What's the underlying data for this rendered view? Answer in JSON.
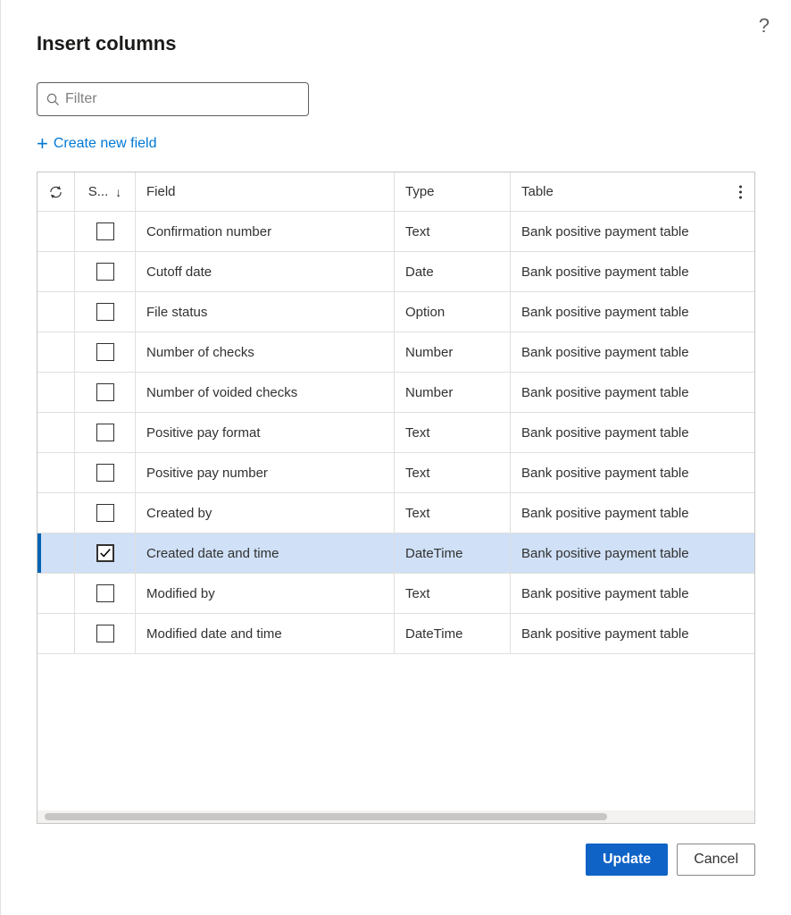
{
  "title": "Insert columns",
  "filter": {
    "placeholder": "Filter"
  },
  "create_link": "Create new field",
  "columns": {
    "select_abbrev": "S...",
    "field": "Field",
    "type": "Type",
    "table": "Table"
  },
  "rows": [
    {
      "field": "Confirmation number",
      "type": "Text",
      "table": "Bank positive payment table",
      "selected": false
    },
    {
      "field": "Cutoff date",
      "type": "Date",
      "table": "Bank positive payment table",
      "selected": false
    },
    {
      "field": "File status",
      "type": "Option",
      "table": "Bank positive payment table",
      "selected": false
    },
    {
      "field": "Number of checks",
      "type": "Number",
      "table": "Bank positive payment table",
      "selected": false
    },
    {
      "field": "Number of voided checks",
      "type": "Number",
      "table": "Bank positive payment table",
      "selected": false
    },
    {
      "field": "Positive pay format",
      "type": "Text",
      "table": "Bank positive payment table",
      "selected": false
    },
    {
      "field": "Positive pay number",
      "type": "Text",
      "table": "Bank positive payment table",
      "selected": false
    },
    {
      "field": "Created by",
      "type": "Text",
      "table": "Bank positive payment table",
      "selected": false
    },
    {
      "field": "Created date and time",
      "type": "DateTime",
      "table": "Bank positive payment table",
      "selected": true
    },
    {
      "field": "Modified by",
      "type": "Text",
      "table": "Bank positive payment table",
      "selected": false
    },
    {
      "field": "Modified date and time",
      "type": "DateTime",
      "table": "Bank positive payment table",
      "selected": false
    }
  ],
  "buttons": {
    "update": "Update",
    "cancel": "Cancel"
  }
}
